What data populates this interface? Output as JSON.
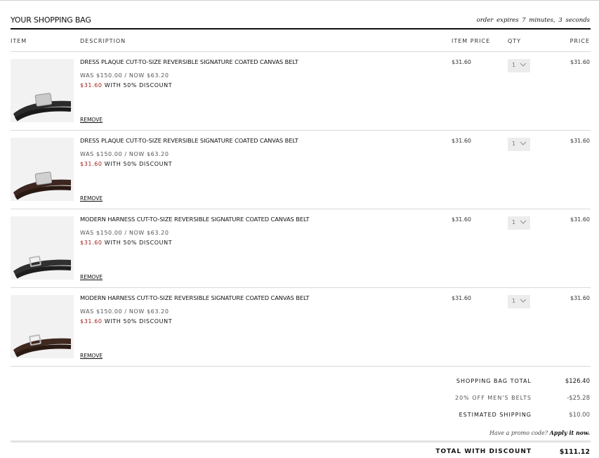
{
  "header": {
    "title": "YOUR SHOPPING BAG",
    "expires_text": "order expires  7  minutes,  3  seconds"
  },
  "columns": {
    "item": "ITEM",
    "description": "DESCRIPTION",
    "item_price": "ITEM PRICE",
    "qty": "QTY",
    "price": "PRICE"
  },
  "items": [
    {
      "name": "DRESS PLAQUE CUT-TO-SIZE REVERSIBLE SIGNATURE COATED CANVAS BELT",
      "was_now": "WAS $150.00 / NOW $63.20",
      "discount_price": "$31.60",
      "discount_text": " WITH 50% DISCOUNT",
      "remove": "REMOVE",
      "item_price": "$31.60",
      "qty": "1",
      "price": "$31.60",
      "thumb_icon": "black-plaque-belt-image",
      "belt_color": "#2a2a2a",
      "buckle_type": "plaque"
    },
    {
      "name": "DRESS PLAQUE CUT-TO-SIZE REVERSIBLE SIGNATURE COATED CANVAS BELT",
      "was_now": "WAS $150.00 / NOW $63.20",
      "discount_price": "$31.60",
      "discount_text": " WITH 50% DISCOUNT",
      "remove": "REMOVE",
      "item_price": "$31.60",
      "qty": "1",
      "price": "$31.60",
      "thumb_icon": "brown-plaque-belt-image",
      "belt_color": "#3e2620",
      "buckle_type": "plaque"
    },
    {
      "name": "MODERN HARNESS CUT-TO-SIZE REVERSIBLE SIGNATURE COATED CANVAS BELT",
      "was_now": "WAS $150.00 / NOW $63.20",
      "discount_price": "$31.60",
      "discount_text": " WITH 50% DISCOUNT",
      "remove": "REMOVE",
      "item_price": "$31.60",
      "qty": "1",
      "price": "$31.60",
      "thumb_icon": "black-harness-belt-image",
      "belt_color": "#303030",
      "buckle_type": "harness"
    },
    {
      "name": "MODERN HARNESS CUT-TO-SIZE REVERSIBLE SIGNATURE COATED CANVAS BELT",
      "was_now": "WAS $150.00 / NOW $63.20",
      "discount_price": "$31.60",
      "discount_text": " WITH 50% DISCOUNT",
      "remove": "REMOVE",
      "item_price": "$31.60",
      "qty": "1",
      "price": "$31.60",
      "thumb_icon": "brown-harness-belt-image",
      "belt_color": "#40291f",
      "buckle_type": "harness"
    }
  ],
  "summary": {
    "bag_total_label": "SHOPPING BAG TOTAL",
    "bag_total": "$126.40",
    "promo_label": "20% OFF MEN'S BELTS",
    "promo_value": "-$25.28",
    "shipping_label": "ESTIMATED SHIPPING",
    "shipping_value": "$10.00",
    "promo_question": "Have a promo code? ",
    "promo_link": "Apply it now.",
    "total_label": "TOTAL WITH DISCOUNT",
    "total_value": "$111.12"
  },
  "colors": {
    "discount_red": "#a21c1c",
    "rule_dark": "#111111",
    "rule_light": "#d9d9d9"
  }
}
